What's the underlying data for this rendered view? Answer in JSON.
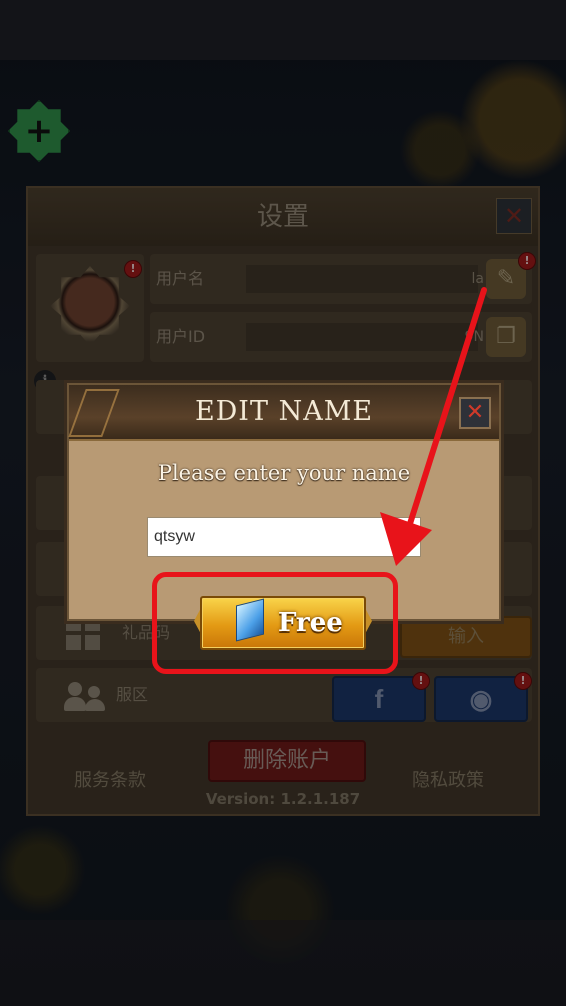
{
  "settings": {
    "title": "设置",
    "close_glyph": "✕",
    "username_label": "用户名",
    "username_tail": "la",
    "userid_label": "用户ID",
    "userid_tail": "9N",
    "badge": "!",
    "info_glyph": "i",
    "gift_row_label": "礼品码",
    "redeem_label": "输入",
    "server_row_label": "服区",
    "facebook_glyph": "f",
    "discord_glyph": "◉",
    "delete_account_label": "删除账户",
    "terms_label": "服务条款",
    "privacy_label": "隐私政策",
    "version": "Version: 1.2.1.187"
  },
  "dialog": {
    "title": "EDIT NAME",
    "prompt": "Please enter your name",
    "name_value": "qtsyw",
    "close_glyph": "✕",
    "free_button_label": "Free"
  },
  "hud": {
    "plus_glyph": "+"
  },
  "colors": {
    "highlight": "#e8131a",
    "arrow": "#e8131a",
    "free_button": "#f0b82a"
  },
  "icons": [
    "plus-icon",
    "feather-icon",
    "copy-icon",
    "info-icon",
    "gift-icon",
    "users-icon",
    "facebook-icon",
    "discord-icon",
    "close-icon",
    "diamond-icon"
  ]
}
